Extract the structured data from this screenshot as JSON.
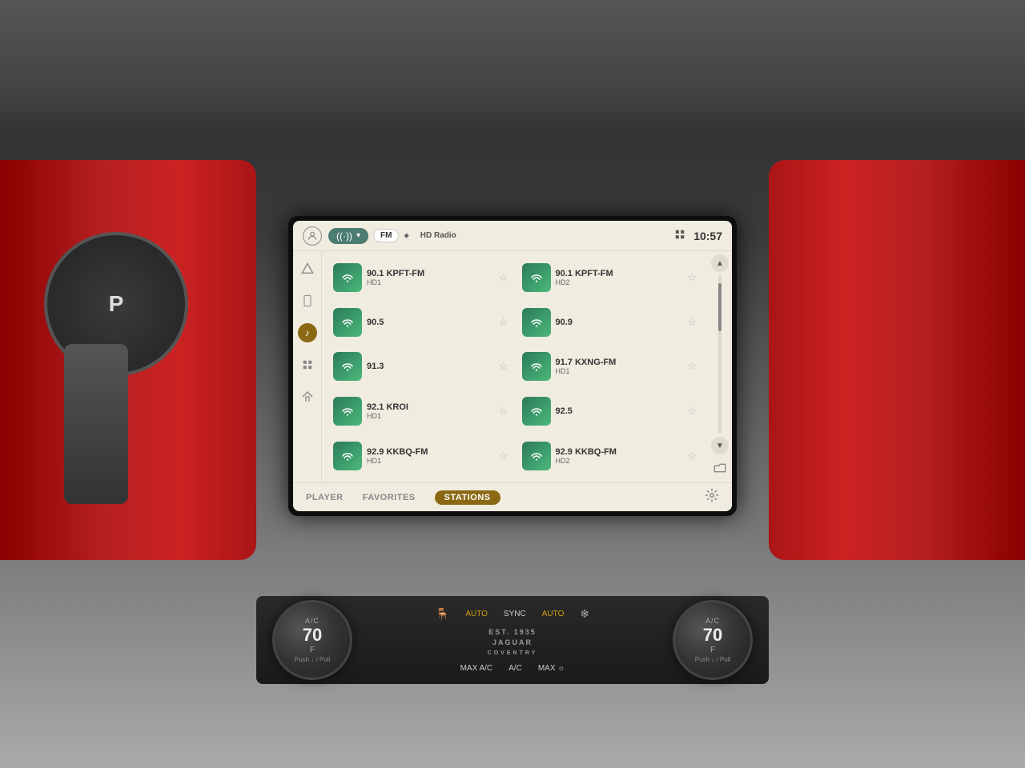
{
  "header": {
    "time": "10:57",
    "source_label": "Radio",
    "fm_tab": "FM",
    "hd_radio_tab": "HD Radio"
  },
  "sidebar": {
    "icons": [
      "nav",
      "phone",
      "music",
      "apps",
      "home"
    ]
  },
  "stations": [
    {
      "freq": "90.1 KPFT-FM",
      "sub": "HD1",
      "col": 0
    },
    {
      "freq": "90.1 KPFT-FM",
      "sub": "HD2",
      "col": 1
    },
    {
      "freq": "90.5",
      "sub": "",
      "col": 0
    },
    {
      "freq": "90.9",
      "sub": "",
      "col": 1
    },
    {
      "freq": "91.3",
      "sub": "",
      "col": 0
    },
    {
      "freq": "91.7 KXNG-FM",
      "sub": "HD1",
      "col": 1
    },
    {
      "freq": "92.1 KROI",
      "sub": "HD1",
      "col": 0
    },
    {
      "freq": "92.5",
      "sub": "",
      "col": 1
    },
    {
      "freq": "92.9 KKBQ-FM",
      "sub": "HD1",
      "col": 0
    },
    {
      "freq": "92.9 KKBQ-FM",
      "sub": "HD2",
      "col": 1
    }
  ],
  "bottom_nav": {
    "player": "PLAYER",
    "favorites": "FAVORITES",
    "stations": "STATIONS"
  },
  "climate": {
    "left_temp": "70",
    "right_temp": "70",
    "temp_unit": "F",
    "temp_sublabel": "Push ↓ / Pull",
    "auto_label": "AUTO",
    "sync_label": "SYNC",
    "max_ac_label": "MAX A/C",
    "ac_label": "A/C",
    "max_heat_label": "MAX"
  },
  "colors": {
    "station_icon_bg": "#2d7a5a",
    "active_nav": "#8B6914",
    "screen_bg": "#f0ece0"
  }
}
